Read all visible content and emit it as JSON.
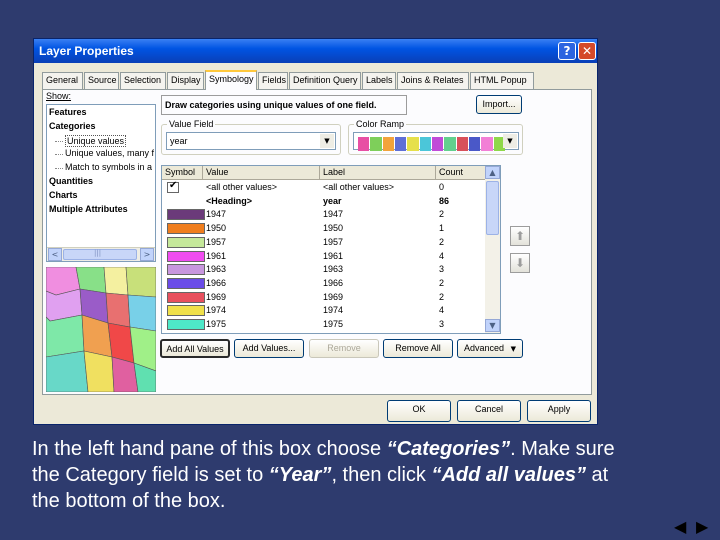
{
  "window": {
    "title": "Layer Properties",
    "help_glyph": "?",
    "close_glyph": "✕"
  },
  "tabs": [
    "General",
    "Source",
    "Selection",
    "Display",
    "Symbology",
    "Fields",
    "Definition Query",
    "Labels",
    "Joins & Relates",
    "HTML Popup"
  ],
  "active_tab": "Symbology",
  "show": {
    "label": "Show:",
    "items": [
      {
        "label": "Features",
        "bold": true,
        "indent": 0
      },
      {
        "label": "Categories",
        "bold": true,
        "indent": 0
      },
      {
        "label": "Unique values",
        "bold": false,
        "indent": 1,
        "selected": true
      },
      {
        "label": "Unique values, many f",
        "bold": false,
        "indent": 1
      },
      {
        "label": "Match to symbols in a",
        "bold": false,
        "indent": 1
      },
      {
        "label": "Quantities",
        "bold": true,
        "indent": 0
      },
      {
        "label": "Charts",
        "bold": true,
        "indent": 0
      },
      {
        "label": "Multiple Attributes",
        "bold": true,
        "indent": 0
      }
    ]
  },
  "description": "Draw categories using unique values of one field.",
  "import_label": "Import...",
  "value_field": {
    "label": "Value Field",
    "value": "year"
  },
  "color_ramp": {
    "label": "Color Ramp",
    "colors": [
      "#e84fa4",
      "#7ecf5a",
      "#f2a33b",
      "#5f6fd6",
      "#e6e04a",
      "#4bc6d9",
      "#c04bd8",
      "#62d08e",
      "#d8505a",
      "#4a58c8",
      "#f27fd6",
      "#8fd84a"
    ]
  },
  "grid": {
    "headers": [
      "Symbol",
      "Value",
      "Label",
      "Count"
    ],
    "rows": [
      {
        "color": "#ffffff",
        "check": true,
        "value": "<all other values>",
        "label": "<all other values>",
        "count": "0",
        "bold": false
      },
      {
        "color": "",
        "value": "<Heading>",
        "label": "year",
        "count": "86",
        "bold": true
      },
      {
        "color": "#6b3a7a",
        "value": "1947",
        "label": "1947",
        "count": "2",
        "bold": false
      },
      {
        "color": "#f07e1e",
        "value": "1950",
        "label": "1950",
        "count": "1",
        "bold": false
      },
      {
        "color": "#c5e89a",
        "value": "1957",
        "label": "1957",
        "count": "2",
        "bold": false
      },
      {
        "color": "#f04cf0",
        "value": "1961",
        "label": "1961",
        "count": "4",
        "bold": false
      },
      {
        "color": "#c896de",
        "value": "1963",
        "label": "1963",
        "count": "3",
        "bold": false
      },
      {
        "color": "#6a4ce8",
        "value": "1966",
        "label": "1966",
        "count": "2",
        "bold": false
      },
      {
        "color": "#e8505e",
        "value": "1969",
        "label": "1969",
        "count": "2",
        "bold": false
      },
      {
        "color": "#f0e04a",
        "value": "1974",
        "label": "1974",
        "count": "4",
        "bold": false
      },
      {
        "color": "#4ee8c8",
        "value": "1975",
        "label": "1975",
        "count": "3",
        "bold": false
      }
    ]
  },
  "buttons": {
    "add_all": "Add All Values",
    "add_values": "Add Values...",
    "remove": "Remove",
    "remove_all": "Remove All",
    "advanced": "Advanced",
    "ok": "OK",
    "cancel": "Cancel",
    "apply": "Apply"
  },
  "scroll_glyphs": {
    "left": "<",
    "right": ">",
    "up": "▲",
    "down": "▼",
    "grip": "|||",
    "move_up": "⬆",
    "move_down": "⬇",
    "dropdown": "▼"
  },
  "instructions": {
    "p1": "In the left hand pane of this box choose ",
    "e1": "“Categories”",
    "p2": ". Make sure the Category field is set to ",
    "e2": "“Year”",
    "p3": ", then click ",
    "e3": "“Add all values”",
    "p4": " at the bottom of the box."
  },
  "nav": {
    "prev": "◀",
    "next": "▶"
  }
}
